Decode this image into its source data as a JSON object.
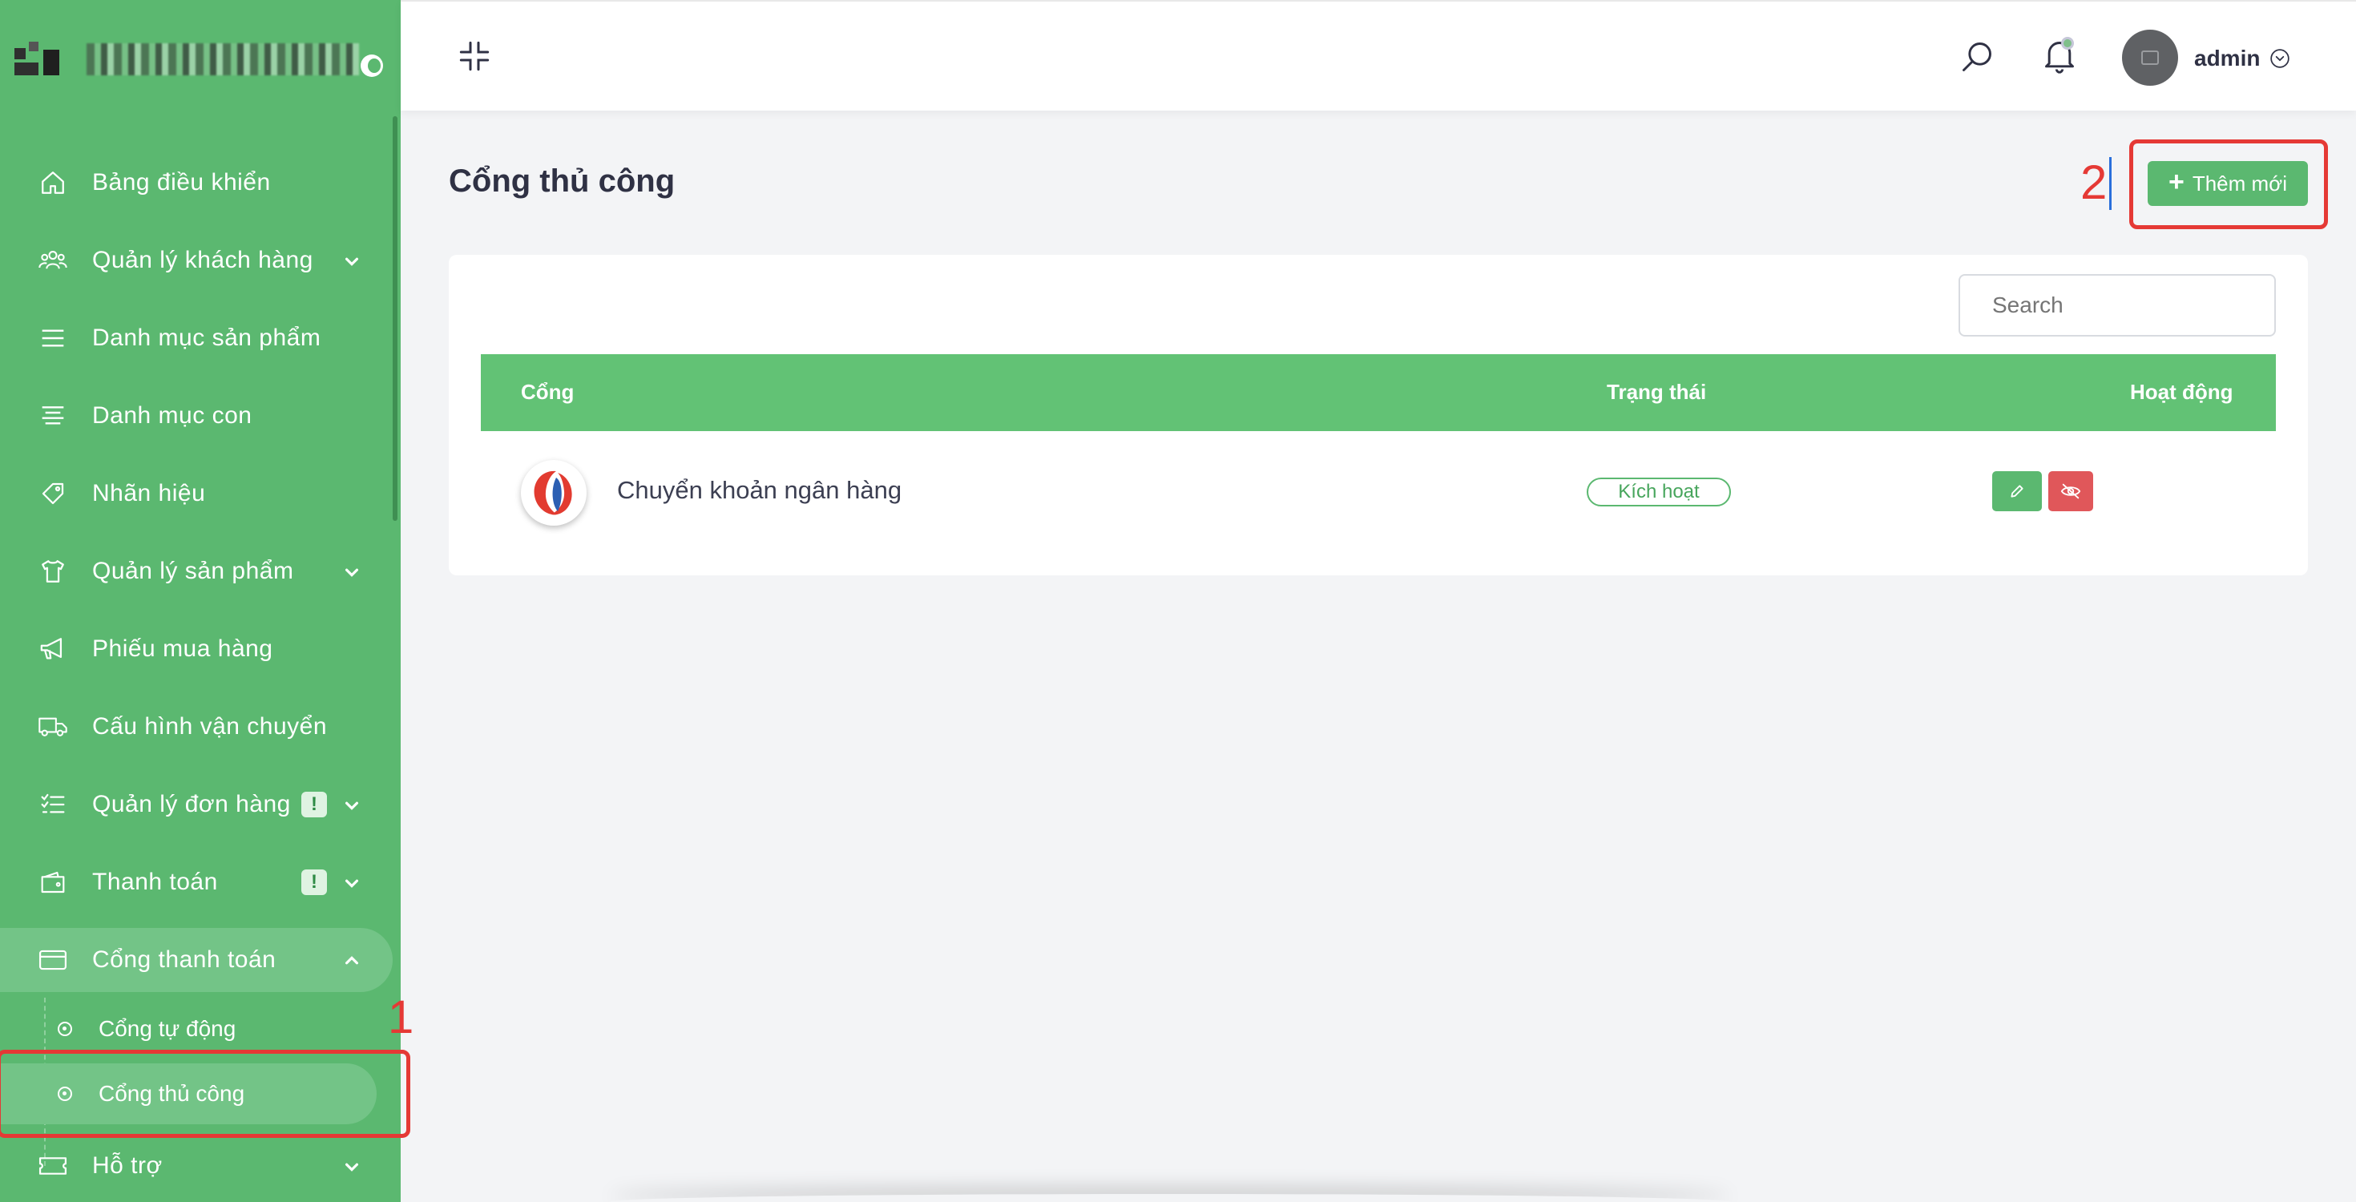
{
  "sidebar": {
    "items": [
      {
        "label": "Bảng điều khiển",
        "icon": "home-icon"
      },
      {
        "label": "Quản lý khách hàng",
        "icon": "users-icon",
        "has_children": true
      },
      {
        "label": "Danh mục sản phẩm",
        "icon": "menu-icon"
      },
      {
        "label": "Danh mục con",
        "icon": "align-center-icon"
      },
      {
        "label": "Nhãn hiệu",
        "icon": "tag-icon"
      },
      {
        "label": "Quản lý sản phẩm",
        "icon": "shirt-icon",
        "has_children": true
      },
      {
        "label": "Phiếu mua hàng",
        "icon": "megaphone-icon"
      },
      {
        "label": "Cấu hình vận chuyển",
        "icon": "truck-icon"
      },
      {
        "label": "Quản lý đơn hàng",
        "icon": "checklist-icon",
        "has_children": true,
        "badge": "!"
      },
      {
        "label": "Thanh toán",
        "icon": "wallet-icon",
        "has_children": true,
        "badge": "!"
      },
      {
        "label": "Cổng thanh toán",
        "icon": "credit-card-icon",
        "has_children": true,
        "expanded": true
      },
      {
        "label": "Hỗ trợ",
        "icon": "ticket-icon",
        "has_children": true
      }
    ],
    "subitems": [
      {
        "label": "Cổng tự động"
      },
      {
        "label": "Cổng thủ công",
        "active": true
      }
    ]
  },
  "topbar": {
    "user_name": "admin"
  },
  "page": {
    "title": "Cổng thủ công",
    "add_button_label": "Thêm mới",
    "search_placeholder": "Search"
  },
  "table": {
    "columns": [
      "Cổng",
      "Trạng thái",
      "Hoạt động"
    ],
    "rows": [
      {
        "name": "Chuyển khoản ngân hàng",
        "status": "Kích hoạt"
      }
    ]
  },
  "annotations": {
    "marker_1": "1",
    "marker_2": "2",
    "color": "#e53935"
  },
  "colors": {
    "sidebar_bg": "#5bb870",
    "table_header": "#62c275",
    "danger": "#e0575a"
  }
}
